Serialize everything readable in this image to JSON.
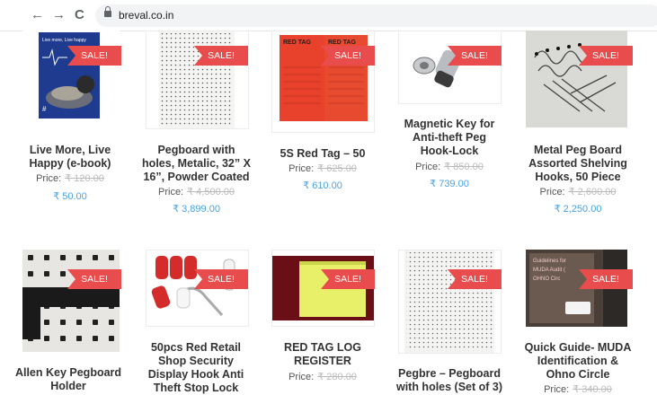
{
  "browser": {
    "url": "breval.co.in",
    "back_icon": "←",
    "forward_icon": "→",
    "reload_icon": "C"
  },
  "sale_label": "SALE!",
  "products": [
    {
      "title": "Live More, Live Happy (e-book)",
      "price_label": "Price:",
      "old_price": "₹ 120.00",
      "new_price": "₹ 50.00"
    },
    {
      "title": "Pegboard with holes, Metalic, 32” X 16”, Powder Coated",
      "price_label": "Price:",
      "old_price": "₹ 4,500.00",
      "new_price": "₹ 3,899.00"
    },
    {
      "title": "5S Red Tag – 50",
      "price_label": "Price:",
      "old_price": "₹ 625.00",
      "new_price": "₹ 610.00"
    },
    {
      "title": "Magnetic Key for Anti-theft Peg Hook-Lock",
      "price_label": "Price:",
      "old_price": "₹ 850.00",
      "new_price": "₹ 739.00"
    },
    {
      "title": "Metal Peg Board Assorted Shelving Hooks, 50 Piece",
      "price_label": "Price:",
      "old_price": "₹ 2,600.00",
      "new_price": "₹ 2,250.00"
    },
    {
      "title": "Allen Key Pegboard Holder"
    },
    {
      "title": "50pcs Red Retail Shop Security Display Hook Anti Theft Stop Lock"
    },
    {
      "title": "RED TAG LOG REGISTER",
      "price_label": "Price:",
      "old_price": "₹ 280.00"
    },
    {
      "title": "Pegbre – Pegboard with holes (Set of 3)"
    },
    {
      "title": "Quick Guide- MUDA Identification & Ohno Circle",
      "price_label": "Price:",
      "old_price": "₹ 340.00"
    }
  ],
  "thumb_text": {
    "book_title": "Live more, Live happy",
    "red_tag_1": "RED TAG",
    "red_tag_2": "RED TAG",
    "guide_line1": "Guidelines for",
    "guide_line2": "MUDA Audit (",
    "guide_line3": "OHNO Circ"
  }
}
